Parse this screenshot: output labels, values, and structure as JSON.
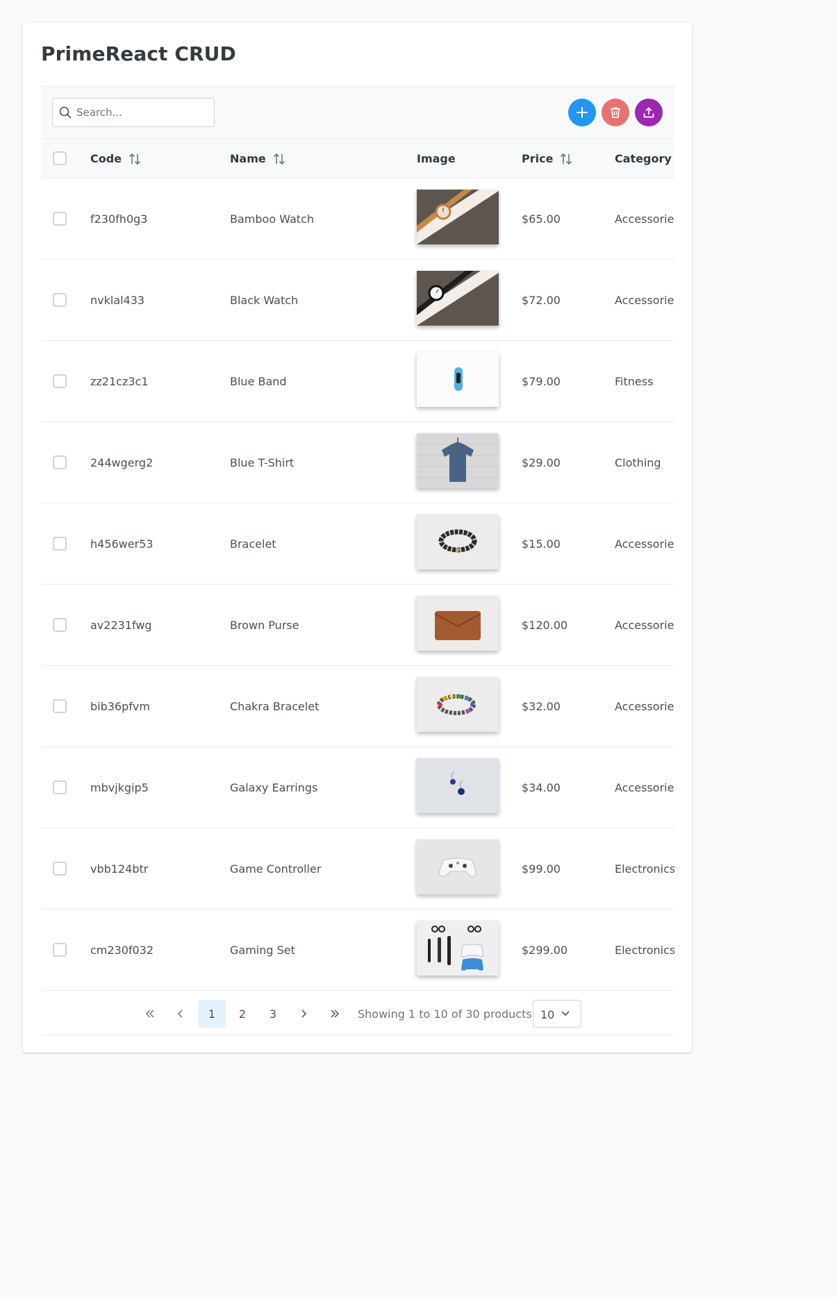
{
  "title": "PrimeReact CRUD",
  "search": {
    "placeholder": "Search..."
  },
  "toolbar": {
    "add_icon": "plus-icon",
    "delete_icon": "trash-icon",
    "export_icon": "upload-icon",
    "colors": {
      "add": "#2196f3",
      "delete": "#e57373",
      "export": "#9c27b0"
    }
  },
  "table": {
    "columns": {
      "code": "Code",
      "name": "Name",
      "image": "Image",
      "price": "Price",
      "category": "Category"
    },
    "rows": [
      {
        "code": "f230fh0g3",
        "name": "Bamboo Watch",
        "price": "$65.00",
        "category": "Accessories",
        "image": "bamboo-watch"
      },
      {
        "code": "nvklal433",
        "name": "Black Watch",
        "price": "$72.00",
        "category": "Accessories",
        "image": "black-watch"
      },
      {
        "code": "zz21cz3c1",
        "name": "Blue Band",
        "price": "$79.00",
        "category": "Fitness",
        "image": "blue-band"
      },
      {
        "code": "244wgerg2",
        "name": "Blue T-Shirt",
        "price": "$29.00",
        "category": "Clothing",
        "image": "blue-t-shirt"
      },
      {
        "code": "h456wer53",
        "name": "Bracelet",
        "price": "$15.00",
        "category": "Accessories",
        "image": "bracelet"
      },
      {
        "code": "av2231fwg",
        "name": "Brown Purse",
        "price": "$120.00",
        "category": "Accessories",
        "image": "brown-purse"
      },
      {
        "code": "bib36pfvm",
        "name": "Chakra Bracelet",
        "price": "$32.00",
        "category": "Accessories",
        "image": "chakra-bracelet"
      },
      {
        "code": "mbvjkgip5",
        "name": "Galaxy Earrings",
        "price": "$34.00",
        "category": "Accessories",
        "image": "galaxy-earrings"
      },
      {
        "code": "vbb124btr",
        "name": "Game Controller",
        "price": "$99.00",
        "category": "Electronics",
        "image": "game-controller"
      },
      {
        "code": "cm230f032",
        "name": "Gaming Set",
        "price": "$299.00",
        "category": "Electronics",
        "image": "gaming-set"
      }
    ]
  },
  "paginator": {
    "pages": [
      "1",
      "2",
      "3"
    ],
    "current_page": "1",
    "report": "Showing 1 to 10 of 30 products",
    "rows_per_page": "10"
  }
}
